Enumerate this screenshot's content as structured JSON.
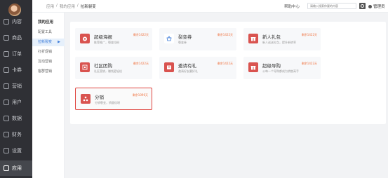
{
  "sidebar": {
    "items": [
      {
        "label": "内容",
        "icon": "document-icon"
      },
      {
        "label": "商品",
        "icon": "bag-icon"
      },
      {
        "label": "订单",
        "icon": "order-icon"
      },
      {
        "label": "卡券",
        "icon": "coupon-icon"
      },
      {
        "label": "营销",
        "icon": "marketing-icon"
      },
      {
        "label": "用户",
        "icon": "user-icon"
      },
      {
        "label": "数据",
        "icon": "chart-icon"
      },
      {
        "label": "财务",
        "icon": "finance-icon"
      },
      {
        "label": "设置",
        "icon": "gear-icon"
      },
      {
        "label": "应用",
        "icon": "apps-icon"
      }
    ],
    "active_index": 9
  },
  "subnav": {
    "title": "我的应用",
    "items": [
      {
        "label": "配置工具"
      },
      {
        "label": "拉新裂变",
        "active": true
      },
      {
        "label": "打折促销"
      },
      {
        "label": "互动营销"
      },
      {
        "label": "客群营销"
      }
    ]
  },
  "topbar": {
    "breadcrumb": [
      "应用",
      "/",
      "我的应用",
      "/",
      "拉新裂变"
    ],
    "help": "帮助中心",
    "search_placeholder": "请输入搜索你要的内容",
    "admin": "管理员"
  },
  "apps": [
    {
      "name": "超级海报",
      "desc": "推荐推广，裂变拉粉",
      "validity": "剩余1422天",
      "icon": "poster-icon",
      "icon_style": "red"
    },
    {
      "name": "裂变券",
      "desc": "裂变券",
      "validity": "剩余1422天",
      "icon": "basket-icon",
      "icon_style": "white"
    },
    {
      "name": "新人礼包",
      "desc": "新人送送礼包，提升新转率",
      "validity": "剩余1422天",
      "icon": "gift-icon",
      "icon_style": "red"
    },
    {
      "name": "社区团购",
      "desc": "社区营销，赚钱更轻松",
      "validity": "剩余1422天",
      "icon": "community-icon",
      "icon_style": "red"
    },
    {
      "name": "邀请有礼",
      "desc": "邀请好友赢好礼",
      "validity": "剩余1422天",
      "icon": "invite-icon",
      "icon_style": "red"
    },
    {
      "name": "超级导购",
      "desc": "公每一个导购都成为销售高手",
      "validity": "剩余1422天",
      "icon": "guide-icon",
      "icon_style": "red"
    },
    {
      "name": "分销",
      "desc": "分销裂变，销量倍增",
      "validity": "剩余1096天",
      "icon": "distribution-icon",
      "icon_style": "red",
      "selected": true
    }
  ],
  "colors": {
    "accent": "#d9534f",
    "selected_border": "#e0453f",
    "sidebar_bg": "#2f3035",
    "validity": "#f0703c"
  }
}
